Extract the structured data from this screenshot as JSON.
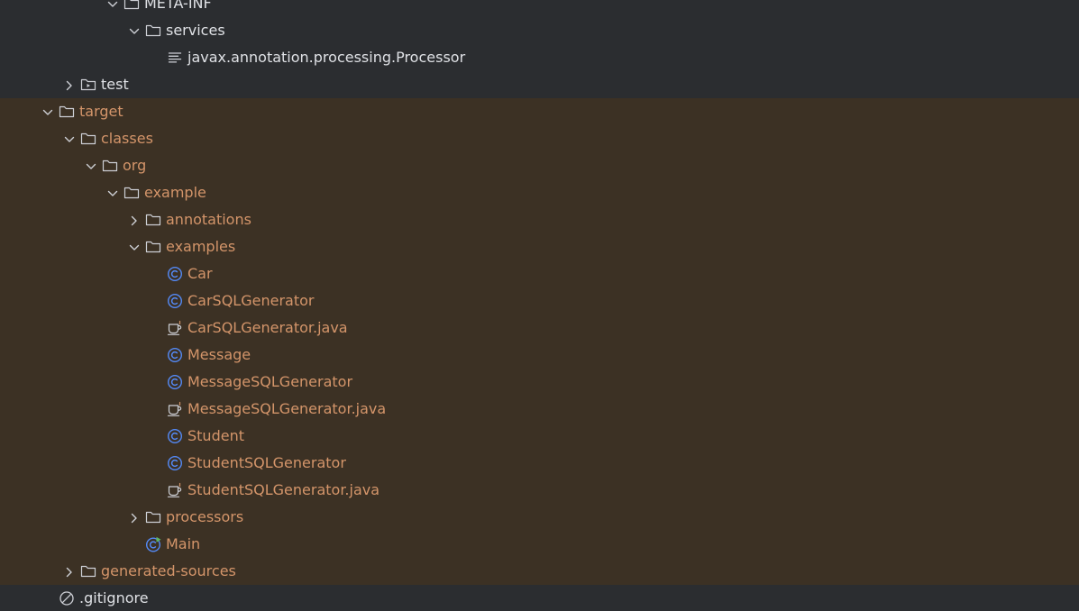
{
  "colors": {
    "background": "#2b2d30",
    "excluded_background": "#3c3124",
    "excluded_text": "#d4956a",
    "normal_text": "#dfe1e5",
    "icon_stroke": "#ced0d6",
    "class_icon": "#548af7",
    "runnable_badge": "#5fb865"
  },
  "tree": {
    "rows": [
      {
        "label": "META-INF",
        "depth": 5,
        "icon": "folder-icon",
        "expander": "chevron-down-icon",
        "excluded": false
      },
      {
        "label": "services",
        "depth": 6,
        "icon": "folder-icon",
        "expander": "chevron-down-icon",
        "excluded": false
      },
      {
        "label": "javax.annotation.processing.Processor",
        "depth": 7,
        "icon": "text-file-icon",
        "expander": "",
        "excluded": false
      },
      {
        "label": "test",
        "depth": 3,
        "icon": "test-folder-icon",
        "expander": "chevron-right-icon",
        "excluded": false
      },
      {
        "label": "target",
        "depth": 2,
        "icon": "folder-icon",
        "expander": "chevron-down-icon",
        "excluded": true
      },
      {
        "label": "classes",
        "depth": 3,
        "icon": "folder-icon",
        "expander": "chevron-down-icon",
        "excluded": true
      },
      {
        "label": "org",
        "depth": 4,
        "icon": "folder-icon",
        "expander": "chevron-down-icon",
        "excluded": true
      },
      {
        "label": "example",
        "depth": 5,
        "icon": "folder-icon",
        "expander": "chevron-down-icon",
        "excluded": true
      },
      {
        "label": "annotations",
        "depth": 6,
        "icon": "folder-icon",
        "expander": "chevron-right-icon",
        "excluded": true
      },
      {
        "label": "examples",
        "depth": 6,
        "icon": "folder-icon",
        "expander": "chevron-down-icon",
        "excluded": true
      },
      {
        "label": "Car",
        "depth": 7,
        "icon": "class-icon",
        "expander": "",
        "excluded": true
      },
      {
        "label": "CarSQLGenerator",
        "depth": 7,
        "icon": "class-icon",
        "expander": "",
        "excluded": true
      },
      {
        "label": "CarSQLGenerator.java",
        "depth": 7,
        "icon": "java-file-icon",
        "expander": "",
        "excluded": true
      },
      {
        "label": "Message",
        "depth": 7,
        "icon": "class-icon",
        "expander": "",
        "excluded": true
      },
      {
        "label": "MessageSQLGenerator",
        "depth": 7,
        "icon": "class-icon",
        "expander": "",
        "excluded": true
      },
      {
        "label": "MessageSQLGenerator.java",
        "depth": 7,
        "icon": "java-file-icon",
        "expander": "",
        "excluded": true
      },
      {
        "label": "Student",
        "depth": 7,
        "icon": "class-icon",
        "expander": "",
        "excluded": true
      },
      {
        "label": "StudentSQLGenerator",
        "depth": 7,
        "icon": "class-icon",
        "expander": "",
        "excluded": true
      },
      {
        "label": "StudentSQLGenerator.java",
        "depth": 7,
        "icon": "java-file-icon",
        "expander": "",
        "excluded": true
      },
      {
        "label": "processors",
        "depth": 6,
        "icon": "folder-icon",
        "expander": "chevron-right-icon",
        "excluded": true
      },
      {
        "label": "Main",
        "depth": 6,
        "icon": "runnable-class-icon",
        "expander": "",
        "excluded": true
      },
      {
        "label": "generated-sources",
        "depth": 3,
        "icon": "folder-icon",
        "expander": "chevron-right-icon",
        "excluded": true
      },
      {
        "label": ".gitignore",
        "depth": 2,
        "icon": "ignored-file-icon",
        "expander": "",
        "excluded": false
      }
    ]
  }
}
